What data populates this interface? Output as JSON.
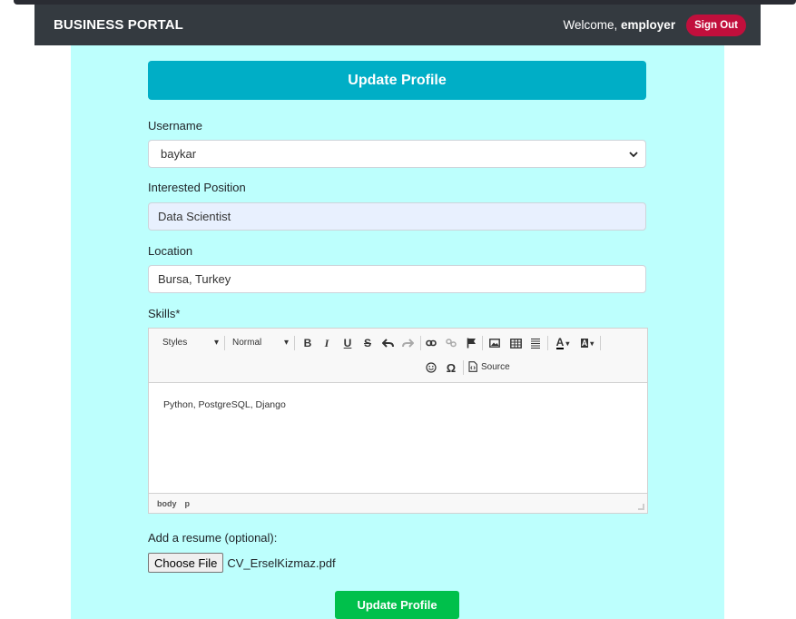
{
  "navbar": {
    "brand": "BUSINESS PORTAL",
    "welcome_prefix": "Welcome,",
    "username": "employer",
    "signout_label": "Sign Out"
  },
  "form": {
    "title": "Update Profile",
    "username_label": "Username",
    "username_value": "baykar",
    "position_label": "Interested Position",
    "position_value": "Data Scientist",
    "location_label": "Location",
    "location_value": "Bursa, Turkey",
    "skills_label": "Skills*",
    "resume_label": "Add a resume (optional):",
    "choose_file_label": "Choose File",
    "file_name": "CV_ErselKizmaz.pdf",
    "submit_label": "Update Profile"
  },
  "editor": {
    "styles_combo": "Styles",
    "format_combo": "Normal",
    "source_label": "Source",
    "content": "Python, PostgreSQL, Django",
    "path": [
      "body",
      "p"
    ]
  },
  "colors": {
    "navbar_bg": "#343a40",
    "panel_bg": "#bdfffd",
    "header_bg": "#00aec6",
    "signout_bg": "#c10f3c",
    "submit_bg": "#00c04b"
  }
}
